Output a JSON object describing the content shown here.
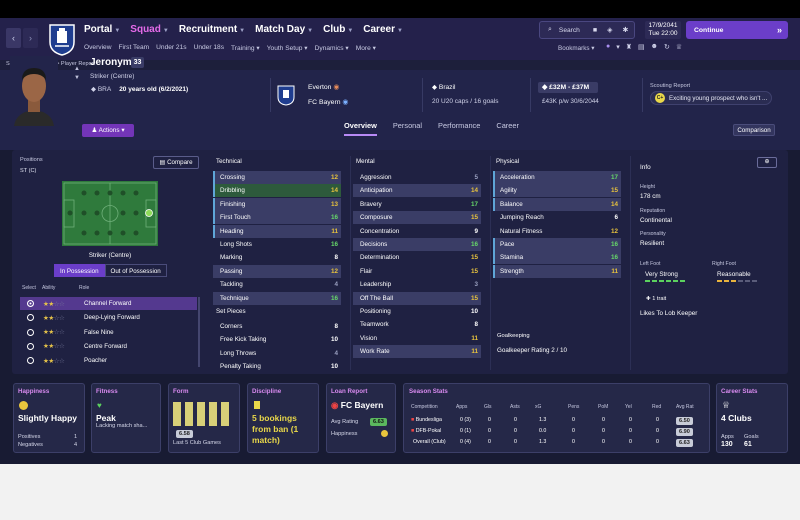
{
  "nav": {
    "main": [
      "Portal",
      "Squad",
      "Recruitment",
      "Match Day",
      "Club",
      "Career"
    ],
    "sub": [
      "Overview",
      "First Team",
      "Under 21s",
      "Under 18s",
      "Training",
      "Youth Setup",
      "Dynamics",
      "More"
    ],
    "search_label": "Search",
    "date_line1": "17/9/2041",
    "date_line2": "Tue  22:00",
    "continue_label": "Continue",
    "bookmarks_label": "Bookmarks"
  },
  "breadcrumb": "Squad > First Team > Player Report",
  "player": {
    "name": "Jeronymo",
    "number": "33",
    "position": "Striker (Centre)",
    "nation_code": "BRA",
    "age": "20 years old (6/2/2021)",
    "actions_label": "Actions",
    "club": "Everton",
    "loan_club": "FC Bayern",
    "country": "Brazil",
    "caps": "20 U20 caps / 16 goals",
    "value": "£32M - £37M",
    "wage": "£43K p/w 30/6/2044",
    "scouting_label": "Scouting Report",
    "scouting_grade": "C+",
    "scouting_text": "Exciting young prospect who isn't ..."
  },
  "tabs": [
    "Overview",
    "Personal",
    "Performance",
    "Career"
  ],
  "compare_label": "Comparison",
  "positions": {
    "label": "Positions",
    "value": "ST (C)",
    "compare_label": "Compare",
    "role_name": "Striker (Centre)",
    "toggle": [
      "In Possession",
      "Out of Possession"
    ],
    "head": [
      "Select",
      "Ability",
      "Role"
    ],
    "roles": [
      {
        "name": "Channel Forward",
        "stars": 2,
        "selected": true
      },
      {
        "name": "Deep-Lying Forward",
        "stars": 2,
        "selected": false
      },
      {
        "name": "False Nine",
        "stars": 2,
        "selected": false
      },
      {
        "name": "Centre Forward",
        "stars": 2,
        "selected": false
      },
      {
        "name": "Poacher",
        "stars": 2,
        "selected": false
      }
    ]
  },
  "technical": {
    "title": "Technical",
    "rows": [
      {
        "name": "Crossing",
        "value": "12",
        "c": "y",
        "hl": 1,
        "mark": 1
      },
      {
        "name": "Dribbling",
        "value": "14",
        "c": "y",
        "hl": 2,
        "mark": 1
      },
      {
        "name": "Finishing",
        "value": "13",
        "c": "y",
        "hl": 1,
        "mark": 1
      },
      {
        "name": "First Touch",
        "value": "16",
        "c": "g",
        "hl": 1,
        "mark": 1
      },
      {
        "name": "Heading",
        "value": "11",
        "c": "y",
        "hl": 1,
        "mark": 1
      },
      {
        "name": "Long Shots",
        "value": "16",
        "c": "g",
        "hl": 0,
        "mark": 0
      },
      {
        "name": "Marking",
        "value": "8",
        "c": "w",
        "hl": 0,
        "mark": 0
      },
      {
        "name": "Passing",
        "value": "12",
        "c": "y",
        "hl": 1,
        "mark": 0
      },
      {
        "name": "Tackling",
        "value": "4",
        "c": "d",
        "hl": 0,
        "mark": 0
      },
      {
        "name": "Technique",
        "value": "16",
        "c": "g",
        "hl": 1,
        "mark": 0
      }
    ]
  },
  "setpieces": {
    "title": "Set Pieces",
    "rows": [
      {
        "name": "Corners",
        "value": "8",
        "c": "w"
      },
      {
        "name": "Free Kick Taking",
        "value": "10",
        "c": "w"
      },
      {
        "name": "Long Throws",
        "value": "4",
        "c": "d"
      },
      {
        "name": "Penalty Taking",
        "value": "10",
        "c": "w"
      }
    ]
  },
  "mental": {
    "title": "Mental",
    "rows": [
      {
        "name": "Aggression",
        "value": "5",
        "c": "d",
        "hl": 0
      },
      {
        "name": "Anticipation",
        "value": "14",
        "c": "y",
        "hl": 1
      },
      {
        "name": "Bravery",
        "value": "17",
        "c": "g",
        "hl": 0
      },
      {
        "name": "Composure",
        "value": "15",
        "c": "y",
        "hl": 1
      },
      {
        "name": "Concentration",
        "value": "9",
        "c": "w",
        "hl": 0
      },
      {
        "name": "Decisions",
        "value": "16",
        "c": "g",
        "hl": 1
      },
      {
        "name": "Determination",
        "value": "15",
        "c": "y",
        "hl": 0
      },
      {
        "name": "Flair",
        "value": "15",
        "c": "y",
        "hl": 0
      },
      {
        "name": "Leadership",
        "value": "3",
        "c": "d",
        "hl": 0
      },
      {
        "name": "Off The Ball",
        "value": "15",
        "c": "y",
        "hl": 1
      },
      {
        "name": "Positioning",
        "value": "10",
        "c": "w",
        "hl": 0
      },
      {
        "name": "Teamwork",
        "value": "8",
        "c": "w",
        "hl": 0
      },
      {
        "name": "Vision",
        "value": "11",
        "c": "y",
        "hl": 0
      },
      {
        "name": "Work Rate",
        "value": "11",
        "c": "y",
        "hl": 1
      }
    ]
  },
  "physical": {
    "title": "Physical",
    "rows": [
      {
        "name": "Acceleration",
        "value": "17",
        "c": "g",
        "hl": 1,
        "mark": 1
      },
      {
        "name": "Agility",
        "value": "15",
        "c": "y",
        "hl": 1,
        "mark": 1
      },
      {
        "name": "Balance",
        "value": "14",
        "c": "y",
        "hl": 1,
        "mark": 1
      },
      {
        "name": "Jumping Reach",
        "value": "6",
        "c": "w",
        "hl": 0,
        "mark": 0
      },
      {
        "name": "Natural Fitness",
        "value": "12",
        "c": "y",
        "hl": 0,
        "mark": 0
      },
      {
        "name": "Pace",
        "value": "16",
        "c": "g",
        "hl": 1,
        "mark": 1
      },
      {
        "name": "Stamina",
        "value": "16",
        "c": "g",
        "hl": 1,
        "mark": 1
      },
      {
        "name": "Strength",
        "value": "11",
        "c": "y",
        "hl": 1,
        "mark": 1
      }
    ],
    "gk_title": "Goalkeeping",
    "gk_rating": "Goalkeeper Rating  2 / 10"
  },
  "info": {
    "title": "Info",
    "height_label": "Height",
    "height": "178 cm",
    "reputation_label": "Reputation",
    "reputation": "Continental",
    "personality_label": "Personality",
    "personality": "Resilient",
    "left_foot_label": "Left Foot",
    "left_foot": "Very Strong",
    "right_foot_label": "Right Foot",
    "right_foot": "Reasonable",
    "traits_label": "1 trait",
    "trait": "Likes To Lob Keeper"
  },
  "cards": {
    "happiness": {
      "title": "Happiness",
      "value": "Slightly Happy",
      "row1": "Positives",
      "row1v": "1",
      "row2": "Negatives",
      "row2v": "4"
    },
    "fitness": {
      "title": "Fitness",
      "value": "Peak",
      "sub": "Lacking match sha..."
    },
    "form": {
      "title": "Form",
      "rating": "6.58",
      "sub": "Last 5 Club Games"
    },
    "discipline": {
      "title": "Discipline",
      "value": "5 bookings from ban (1 match)"
    },
    "loan": {
      "title": "Loan Report",
      "club": "FC Bayern",
      "avg_label": "Avg Rating",
      "avg": "6.63",
      "happy_label": "Happiness"
    },
    "season": {
      "title": "Season Stats",
      "head": [
        "Competition",
        "Apps",
        "Gls",
        "Asts",
        "xG",
        "Pens",
        "PoM",
        "Yel",
        "Red",
        "Avg Rat"
      ],
      "rows": [
        {
          "comp": "Bundesliga",
          "vals": [
            "0 (3)",
            "0",
            "0",
            "1.3",
            "0",
            "0",
            "0",
            "0"
          ],
          "rating": "6.50"
        },
        {
          "comp": "DFB-Pokal",
          "vals": [
            "0 (1)",
            "0",
            "0",
            "0.0",
            "0",
            "0",
            "0",
            "0"
          ],
          "rating": "6.90"
        },
        {
          "comp": "Overall (Club)",
          "vals": [
            "0 (4)",
            "0",
            "0",
            "1.3",
            "0",
            "0",
            "0",
            "0"
          ],
          "rating": "6.63"
        }
      ]
    },
    "career": {
      "title": "Career Stats",
      "clubs": "4 Clubs",
      "apps_label": "Apps",
      "apps": "130",
      "goals_label": "Goals",
      "goals": "61"
    }
  },
  "colors": {
    "accent": "#6b3ec9",
    "title_pink": "#d88aef",
    "good": "#67d96a",
    "mid": "#e8c33d"
  }
}
